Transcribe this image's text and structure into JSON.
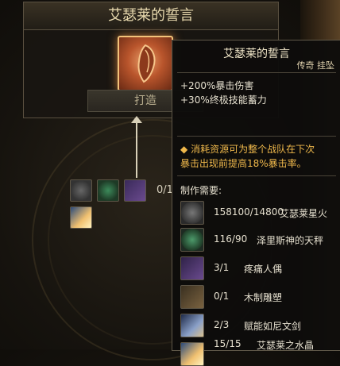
{
  "item": {
    "title": "艾瑟莱的誓言",
    "forge_label": "打造"
  },
  "tooltip": {
    "title": "艾瑟莱的誓言",
    "rarity": "传奇 挂坠",
    "stats": [
      "+200%暴击伤害",
      "+30%终极技能蓄力"
    ],
    "effect_bullet": "◆",
    "effect_line1": "消耗资源可为整个战队在下次",
    "effect_line2": "暴击出现前提高18%暴击率。",
    "requirements_label": "制作需要:",
    "materials": [
      {
        "icon": "grey-rune-orb-icon",
        "count": "158100/14800",
        "name": "艾瑟莱星火"
      },
      {
        "icon": "green-rune-orb-icon",
        "count": "116/90",
        "name": "泽里斯神的天秤"
      },
      {
        "icon": "purple-doll-icon",
        "count": "3/1",
        "name": "疼痛人偶"
      },
      {
        "icon": "wood-carving-icon",
        "count": "0/1",
        "name": "木制雕塑"
      },
      {
        "icon": "rune-sword-icon",
        "count": "2/3",
        "name": "赋能如尼文剑"
      },
      {
        "icon": "crystal-icon",
        "count": "15/15",
        "name": "艾瑟莱之水晶"
      }
    ]
  },
  "ingredients_partial_count": "0/1",
  "colors": {
    "legendary_accent": "#efb84b",
    "title_gold": "#e8d9ae"
  }
}
